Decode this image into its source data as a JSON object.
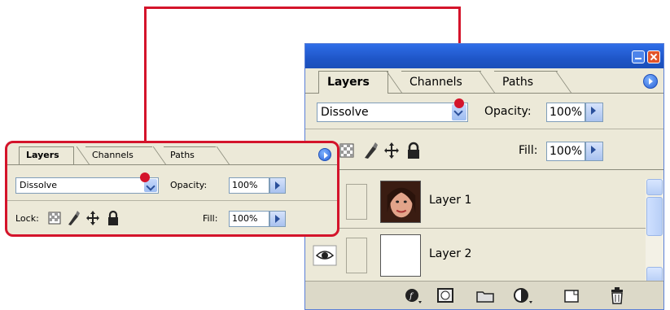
{
  "panel": {
    "tabs": [
      "Layers",
      "Channels",
      "Paths"
    ],
    "blend_mode": "Dissolve",
    "opacity_label": "Opacity:",
    "opacity_value": "100%",
    "lock_label": "k:",
    "fill_label": "Fill:",
    "fill_value": "100%",
    "layers": [
      {
        "name": "Layer 1",
        "visible": false,
        "thumbnail": "photo-portrait"
      },
      {
        "name": "Layer 2",
        "visible": true,
        "thumbnail": "blank-white"
      }
    ],
    "bottom_icons": [
      "layer-style-icon",
      "layer-mask-icon",
      "new-group-icon",
      "adjustment-layer-icon",
      "new-layer-icon",
      "delete-layer-icon"
    ]
  },
  "zoom": {
    "tabs": [
      "Layers",
      "Channels",
      "Paths"
    ],
    "blend_mode": "Dissolve",
    "opacity_label": "Opacity:",
    "opacity_value": "100%",
    "lock_label": "Lock:",
    "fill_label": "Fill:",
    "fill_value": "100%"
  },
  "colors": {
    "callout": "#d4142b",
    "titlebar": "#2358d0",
    "panel_bg": "#ece9d8"
  }
}
